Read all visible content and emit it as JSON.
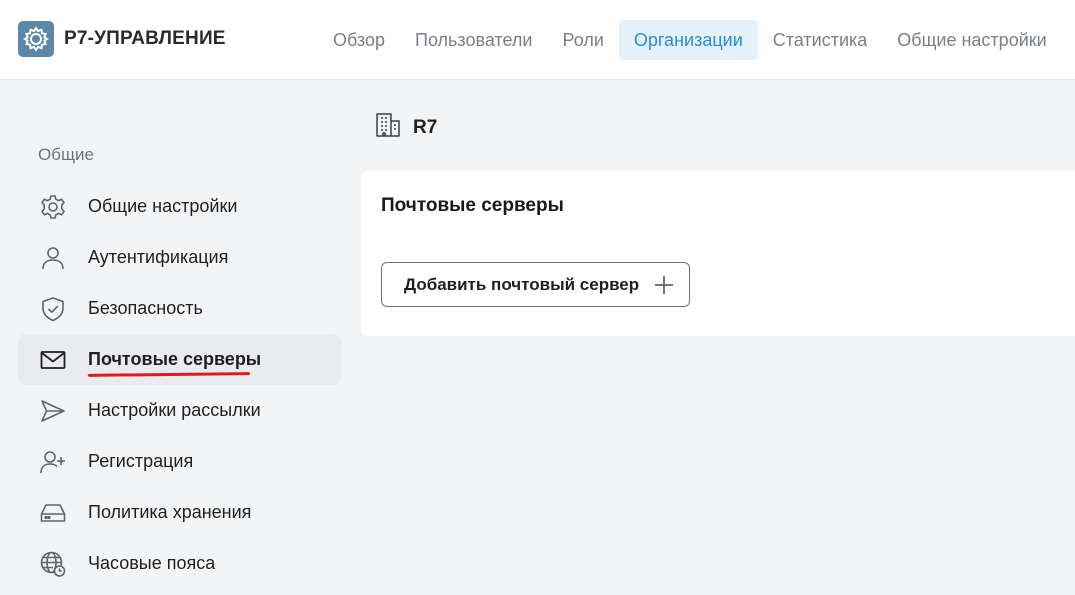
{
  "app": {
    "title": "Р7-УПРАВЛЕНИЕ",
    "logo_icon": "gear-logo-icon",
    "brand_color": "#5c87a6"
  },
  "nav": {
    "items": [
      {
        "label": "Обзор",
        "active": false
      },
      {
        "label": "Пользователи",
        "active": false
      },
      {
        "label": "Роли",
        "active": false
      },
      {
        "label": "Организации",
        "active": true
      },
      {
        "label": "Статистика",
        "active": false
      },
      {
        "label": "Общие настройки",
        "active": false
      }
    ],
    "active_color": "#2f8bd6",
    "active_bg": "#e6f2fb"
  },
  "sidebar": {
    "section_title": "Общие",
    "items": [
      {
        "label": "Общие настройки",
        "icon": "gear-icon",
        "active": false
      },
      {
        "label": "Аутентификация",
        "icon": "user-icon",
        "active": false
      },
      {
        "label": "Безопасность",
        "icon": "shield-check-icon",
        "active": false
      },
      {
        "label": "Почтовые серверы",
        "icon": "mail-icon",
        "active": true
      },
      {
        "label": "Настройки рассылки",
        "icon": "send-icon",
        "active": false
      },
      {
        "label": "Регистрация",
        "icon": "user-plus-icon",
        "active": false
      },
      {
        "label": "Политика хранения",
        "icon": "storage-icon",
        "active": false
      },
      {
        "label": "Часовые пояса",
        "icon": "globe-clock-icon",
        "active": false
      }
    ],
    "highlight_color": "#e11b1b"
  },
  "organization": {
    "name": "R7",
    "icon": "building-icon"
  },
  "main": {
    "card_title": "Почтовые серверы",
    "add_button_label": "Добавить почтовый сервер",
    "add_button_icon": "plus-icon"
  }
}
